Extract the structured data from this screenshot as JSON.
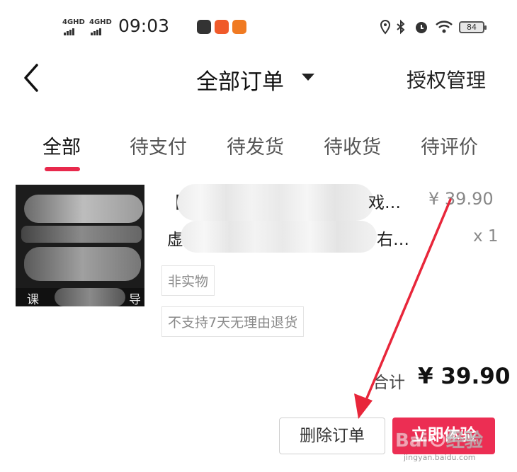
{
  "status_bar": {
    "signal_1": "4GHD",
    "signal_2": "4GHD",
    "time": "09:03",
    "battery": "84"
  },
  "nav": {
    "title": "全部订单",
    "auth": "授权管理"
  },
  "tabs": [
    {
      "label": "全部",
      "active": true
    },
    {
      "label": "待支付",
      "active": false
    },
    {
      "label": "待发货",
      "active": false
    },
    {
      "label": "待收货",
      "active": false
    },
    {
      "label": "待评价",
      "active": false
    }
  ],
  "order": {
    "thumb_caption_left": "课",
    "thumb_caption_right": "导",
    "title_start": "【",
    "title_end": "戏…",
    "sku_start": "虚",
    "sku_end": "右…",
    "price": "¥ 39.90",
    "quantity": "x 1",
    "tags": [
      "非实物",
      "不支持7天无理由退货"
    ],
    "total_label": "合计",
    "total_value": "¥ 39.90",
    "buttons": {
      "delete": "删除订单",
      "primary": "立即体验"
    }
  },
  "watermark": {
    "text": "jingyan.baidu.com"
  },
  "colors": {
    "accent": "#e8294c",
    "primary_button": "#ec2e53",
    "arrow": "#e8263a"
  }
}
